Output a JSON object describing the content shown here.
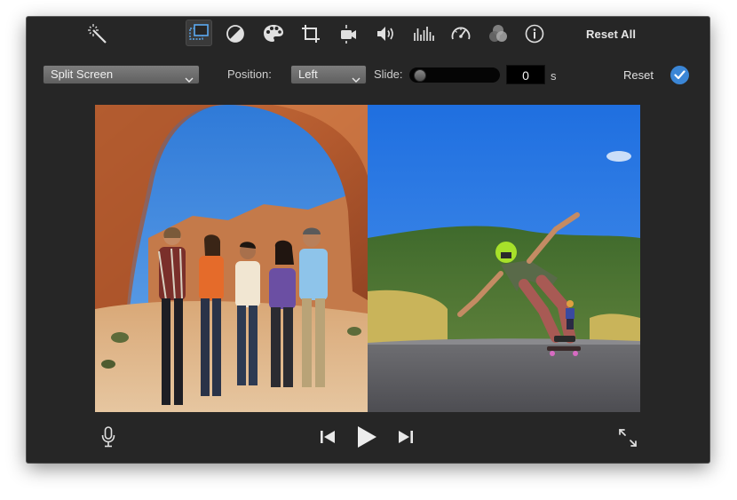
{
  "toolbar": {
    "icons": [
      {
        "name": "enhance-wand-icon"
      },
      {
        "name": "video-overlay-icon",
        "active": true
      },
      {
        "name": "color-balance-icon"
      },
      {
        "name": "color-correction-icon"
      },
      {
        "name": "crop-icon"
      },
      {
        "name": "stabilization-icon"
      },
      {
        "name": "volume-icon"
      },
      {
        "name": "noise-reduction-equalizer-icon"
      },
      {
        "name": "speed-icon"
      },
      {
        "name": "clip-filter-icon"
      },
      {
        "name": "info-icon"
      }
    ],
    "reset_all_label": "Reset All"
  },
  "overlay_controls": {
    "overlay_type": "Split Screen",
    "position_label": "Position:",
    "position_value": "Left",
    "slide_label": "Slide:",
    "slide_value": "0",
    "slide_unit": "s",
    "slide_fraction": 0,
    "reset_label": "Reset"
  },
  "viewer": {
    "left_clip": "friends-at-arch",
    "right_clip": "skateboarder-downhill"
  },
  "playback": {
    "icons": [
      "microphone-icon",
      "skip-back-icon",
      "play-icon",
      "skip-forward-icon",
      "fullscreen-icon"
    ]
  },
  "colors": {
    "accent": "#3b86d6",
    "window_bg": "#262626"
  }
}
